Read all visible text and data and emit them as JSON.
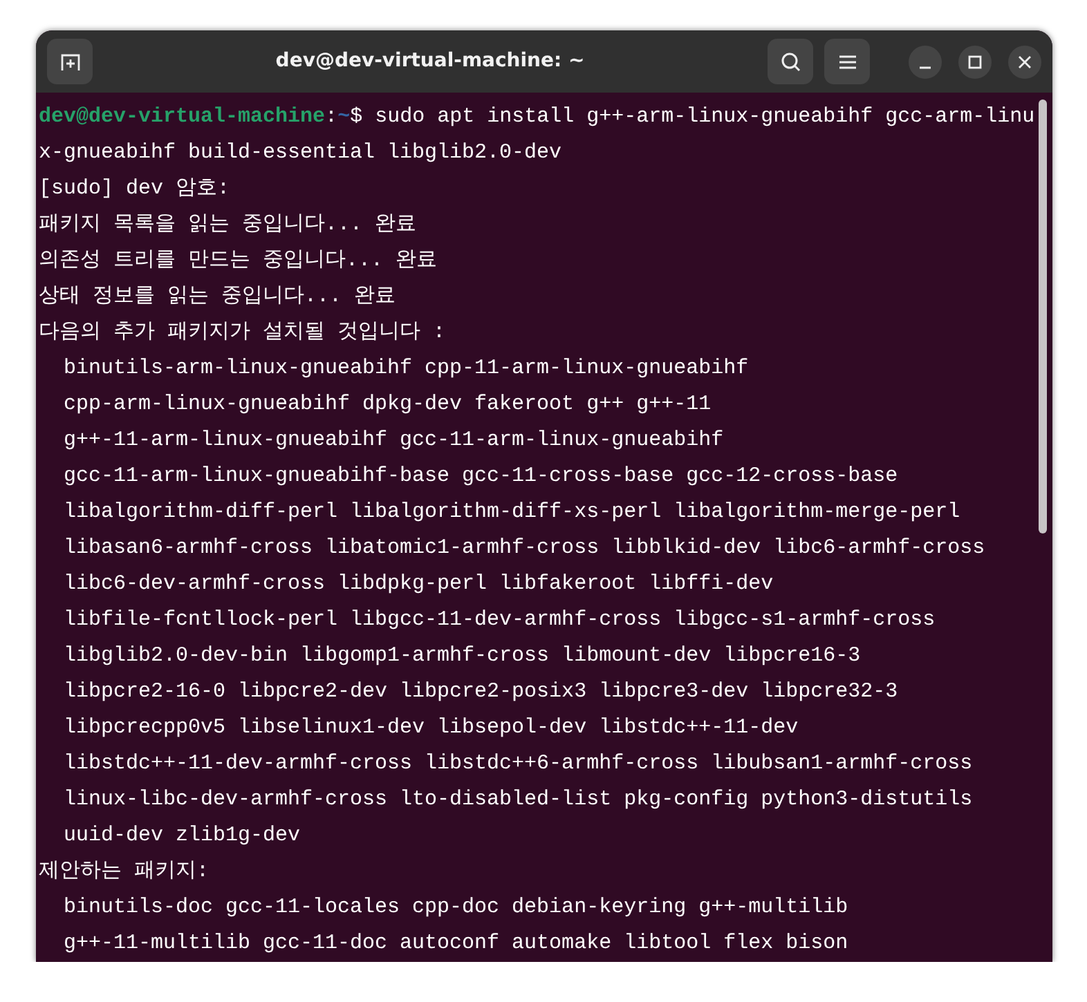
{
  "window": {
    "title": "dev@dev-virtual-machine: ~"
  },
  "terminal": {
    "lines": [
      {
        "kind": "prompt",
        "user_host": "dev@dev-virtual-machine",
        "separator": ":",
        "path": "~",
        "symbol": "$",
        "command": "sudo apt install g++-arm-linux-gnueabihf gcc-arm-linu"
      },
      {
        "kind": "output",
        "text": "x-gnueabihf build-essential libglib2.0-dev"
      },
      {
        "kind": "output",
        "text": "[sudo] dev 암호:"
      },
      {
        "kind": "output",
        "text": "패키지 목록을 읽는 중입니다... 완료"
      },
      {
        "kind": "output",
        "text": "의존성 트리를 만드는 중입니다... 완료"
      },
      {
        "kind": "output",
        "text": "상태 정보를 읽는 중입니다... 완료"
      },
      {
        "kind": "output",
        "text": "다음의 추가 패키지가 설치될 것입니다 :"
      },
      {
        "kind": "output",
        "text": "  binutils-arm-linux-gnueabihf cpp-11-arm-linux-gnueabihf"
      },
      {
        "kind": "output",
        "text": "  cpp-arm-linux-gnueabihf dpkg-dev fakeroot g++ g++-11"
      },
      {
        "kind": "output",
        "text": "  g++-11-arm-linux-gnueabihf gcc-11-arm-linux-gnueabihf"
      },
      {
        "kind": "output",
        "text": "  gcc-11-arm-linux-gnueabihf-base gcc-11-cross-base gcc-12-cross-base"
      },
      {
        "kind": "output",
        "text": "  libalgorithm-diff-perl libalgorithm-diff-xs-perl libalgorithm-merge-perl"
      },
      {
        "kind": "output",
        "text": "  libasan6-armhf-cross libatomic1-armhf-cross libblkid-dev libc6-armhf-cross"
      },
      {
        "kind": "output",
        "text": "  libc6-dev-armhf-cross libdpkg-perl libfakeroot libffi-dev"
      },
      {
        "kind": "output",
        "text": "  libfile-fcntllock-perl libgcc-11-dev-armhf-cross libgcc-s1-armhf-cross"
      },
      {
        "kind": "output",
        "text": "  libglib2.0-dev-bin libgomp1-armhf-cross libmount-dev libpcre16-3"
      },
      {
        "kind": "output",
        "text": "  libpcre2-16-0 libpcre2-dev libpcre2-posix3 libpcre3-dev libpcre32-3"
      },
      {
        "kind": "output",
        "text": "  libpcrecpp0v5 libselinux1-dev libsepol-dev libstdc++-11-dev"
      },
      {
        "kind": "output",
        "text": "  libstdc++-11-dev-armhf-cross libstdc++6-armhf-cross libubsan1-armhf-cross"
      },
      {
        "kind": "output",
        "text": "  linux-libc-dev-armhf-cross lto-disabled-list pkg-config python3-distutils"
      },
      {
        "kind": "output",
        "text": "  uuid-dev zlib1g-dev"
      },
      {
        "kind": "output",
        "text": "제안하는 패키지:"
      },
      {
        "kind": "output",
        "text": "  binutils-doc gcc-11-locales cpp-doc debian-keyring g++-multilib"
      },
      {
        "kind": "output",
        "text": "  g++-11-multilib gcc-11-doc autoconf automake libtool flex bison"
      }
    ]
  }
}
